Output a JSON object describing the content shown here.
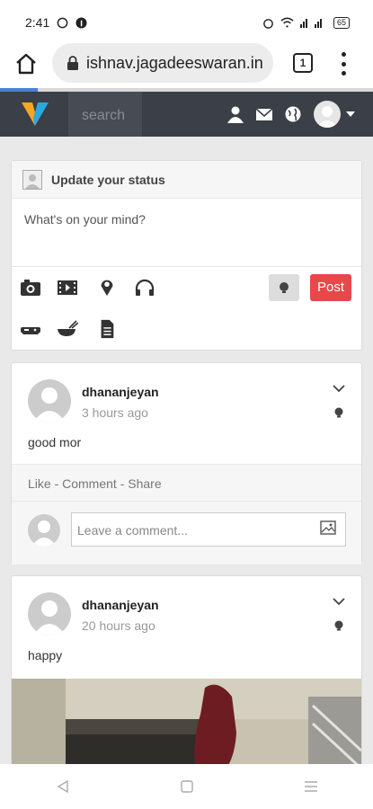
{
  "status_bar": {
    "time": "2:41",
    "battery": "65"
  },
  "browser": {
    "url": "ishnav.jagadeeswaran.in",
    "tab_count": "1"
  },
  "navbar": {
    "search_placeholder": "search"
  },
  "status_box": {
    "title": "Update your status",
    "placeholder": "What's on your mind?",
    "post_label": "Post",
    "tools": [
      "camera-icon",
      "video-icon",
      "location-icon",
      "headphones-icon",
      "game-icon",
      "food-icon",
      "document-icon"
    ]
  },
  "posts": [
    {
      "author": "dhananjeyan",
      "time": "3 hours ago",
      "text": "good mor",
      "actions": "Like - Comment - Share",
      "comment_placeholder": "Leave a comment..."
    },
    {
      "author": "dhananjeyan",
      "time": "20 hours ago",
      "text": "happy"
    }
  ],
  "colors": {
    "navbar": "#3b3f47",
    "post_button": "#e8474b",
    "logo_blue": "#2aa9e0",
    "logo_orange": "#f5a623"
  }
}
